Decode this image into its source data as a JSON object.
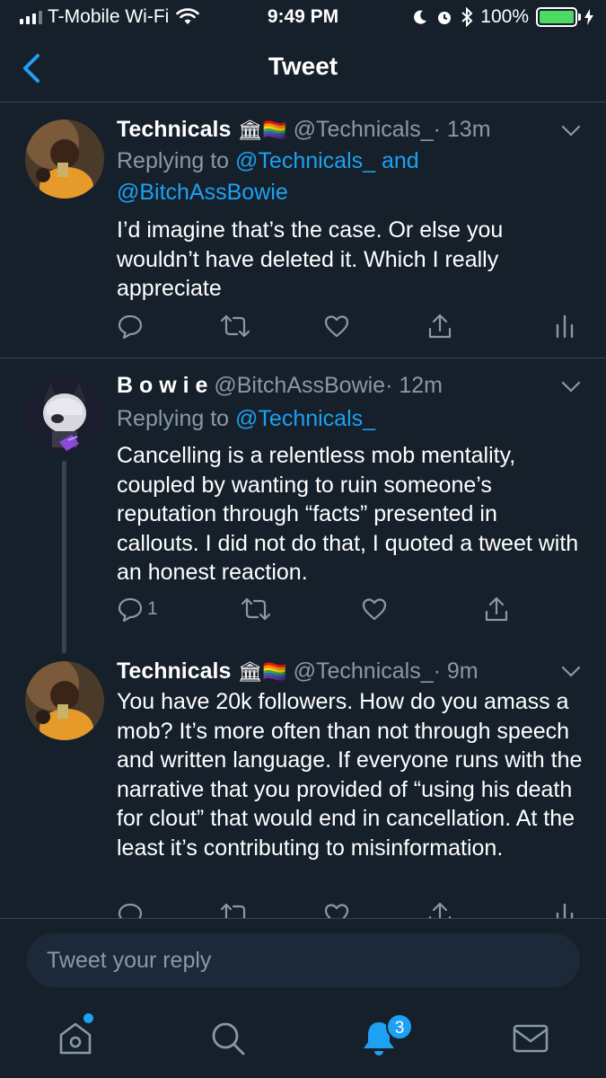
{
  "status_bar": {
    "carrier": "T-Mobile Wi-Fi",
    "time": "9:49 PM",
    "battery": "100%"
  },
  "nav": {
    "title": "Tweet"
  },
  "tweets": [
    {
      "name": "Technicals",
      "emoji": "🏛🏳️‍🌈",
      "handle": "@Technicals_",
      "time": "· 13m",
      "replying_prefix": "Replying to ",
      "replying_to": "@Technicals_ and @BitchAssBowie",
      "text": "I’d imagine that’s the case. Or else you wouldn’t have deleted it. Which I really appreciate",
      "reply_count": ""
    },
    {
      "name": "B o w i e",
      "handle": "@BitchAssBowie",
      "time": "· 12m",
      "replying_prefix": "Replying to ",
      "replying_to": "@Technicals_",
      "text": "Cancelling is a relentless mob mentality, coupled by wanting to ruin someone’s reputation through “facts” presented in callouts. I did not do that, I quoted a tweet with an honest reaction.",
      "reply_count": "1"
    },
    {
      "name": "Technicals",
      "emoji": "🏛🏳️‍🌈",
      "handle": "@Technicals_",
      "time": "· 9m",
      "text": "You have 20k followers. How do you amass a mob? It’s more often than not through speech and written language. If everyone runs with the narrative that you provided of “using his death for clout” that would end in cancellation. At the least it’s contributing to misinformation."
    }
  ],
  "reply_box": {
    "placeholder": "Tweet your reply"
  },
  "tabs": {
    "notifications_badge": "3"
  },
  "colors": {
    "background": "#15202b",
    "accent": "#1da1f2",
    "muted": "#8899a6",
    "divider": "#38444d"
  },
  "icons": [
    "back-icon",
    "chevron-down-icon",
    "reply-icon",
    "retweet-icon",
    "like-icon",
    "share-icon",
    "analytics-icon",
    "home-icon",
    "search-icon",
    "notifications-icon",
    "messages-icon"
  ]
}
